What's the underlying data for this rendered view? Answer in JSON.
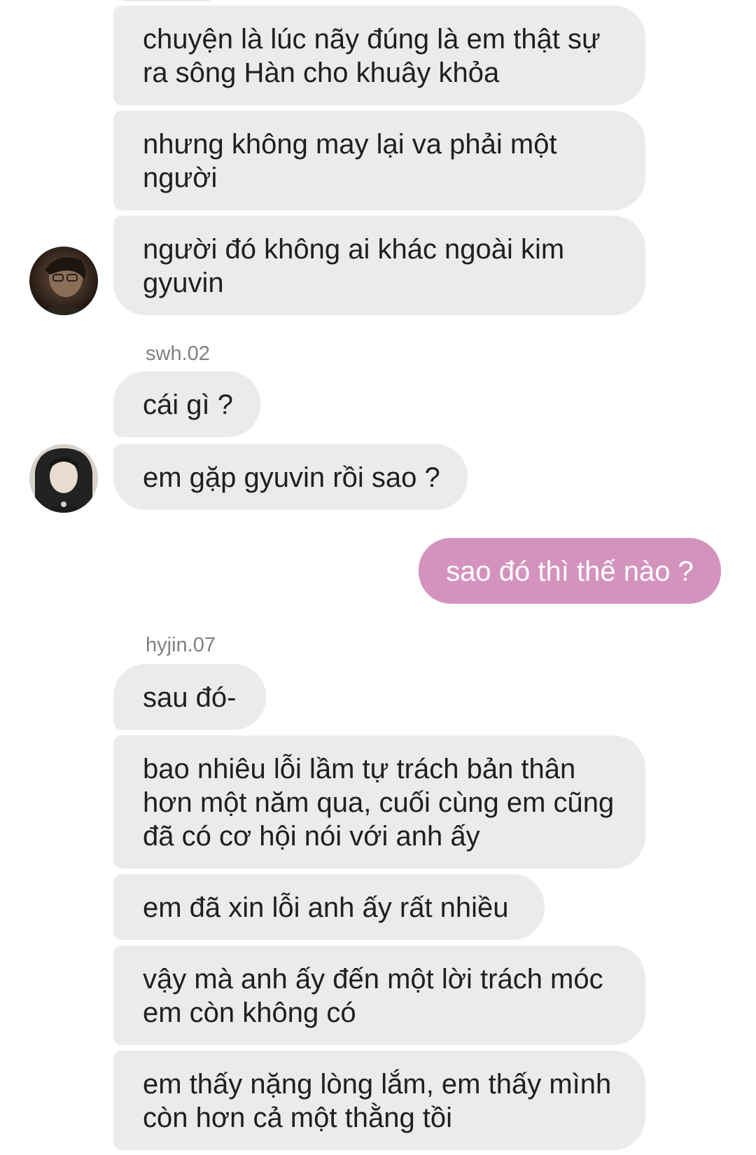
{
  "thread": [
    {
      "kind": "incoming",
      "text": "chuyện là lúc nãy đúng là em thật sự\nra sông Hàn cho khuây khỏa"
    },
    {
      "kind": "incoming",
      "text": "nhưng không may lại va phải một\nngười"
    },
    {
      "kind": "incoming",
      "text": "người đó không ai khác ngoài kim\ngyuvin"
    },
    {
      "kind": "username",
      "text": "swh.02"
    },
    {
      "kind": "incoming",
      "text": "cái gì ?"
    },
    {
      "kind": "incoming",
      "text": "em gặp gyuvin rồi sao ?"
    },
    {
      "kind": "outgoing",
      "text": "sao đó thì thế nào ?"
    },
    {
      "kind": "username",
      "text": "hyjin.07"
    },
    {
      "kind": "incoming",
      "text": "sau đó-"
    },
    {
      "kind": "incoming",
      "text": "bao nhiêu lỗi lầm tự trách bản thân\nhơn một năm qua, cuối cùng em cũng\nđã có cơ hội nói với anh ấy"
    },
    {
      "kind": "incoming",
      "text": "em đã xin lỗi anh ấy rất nhiều"
    },
    {
      "kind": "incoming",
      "text": "vậy mà anh ấy đến một lời trách móc\nem còn không có"
    },
    {
      "kind": "incoming",
      "text": "em thấy nặng lòng lắm, em thấy mình\ncòn hơn cả một thằng tồi"
    }
  ],
  "colors": {
    "incoming_bubble": "#ebebeb",
    "outgoing_bubble": "#d493bd",
    "username": "#808080"
  },
  "icons": {
    "avatar_1": "avatar-hyjin",
    "avatar_2": "avatar-swh"
  }
}
